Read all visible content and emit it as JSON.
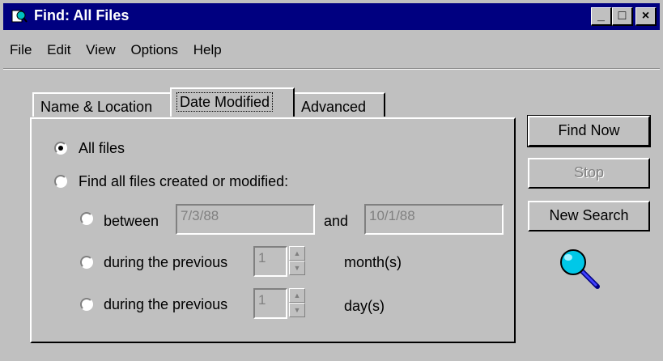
{
  "window": {
    "title": "Find: All Files",
    "controls": {
      "minimize": "_",
      "maximize": "□",
      "close": "×"
    }
  },
  "menu": [
    {
      "label": "File"
    },
    {
      "label": "Edit"
    },
    {
      "label": "View"
    },
    {
      "label": "Options"
    },
    {
      "label": "Help"
    }
  ],
  "tabs": [
    {
      "label": "Name & Location"
    },
    {
      "label": "Date Modified",
      "active": true
    },
    {
      "label": "Advanced"
    }
  ],
  "options": {
    "all_files": "All files",
    "find_all": "Find all files created or modified:",
    "between": "between",
    "between_from": "7/3/88",
    "and": "and",
    "between_to": "10/1/88",
    "during_prev_1": "during the previous",
    "months_value": "1",
    "months_unit": "month(s)",
    "during_prev_2": "during the previous",
    "days_value": "1",
    "days_unit": "day(s)"
  },
  "buttons": {
    "find_now": "Find Now",
    "stop": "Stop",
    "new_search": "New Search"
  },
  "icons": {
    "search": "magnifying-glass-icon",
    "app": "find-app-icon"
  },
  "colors": {
    "titlebar": "#000080",
    "face": "#c0c0c0",
    "disabled_text": "#808080"
  }
}
